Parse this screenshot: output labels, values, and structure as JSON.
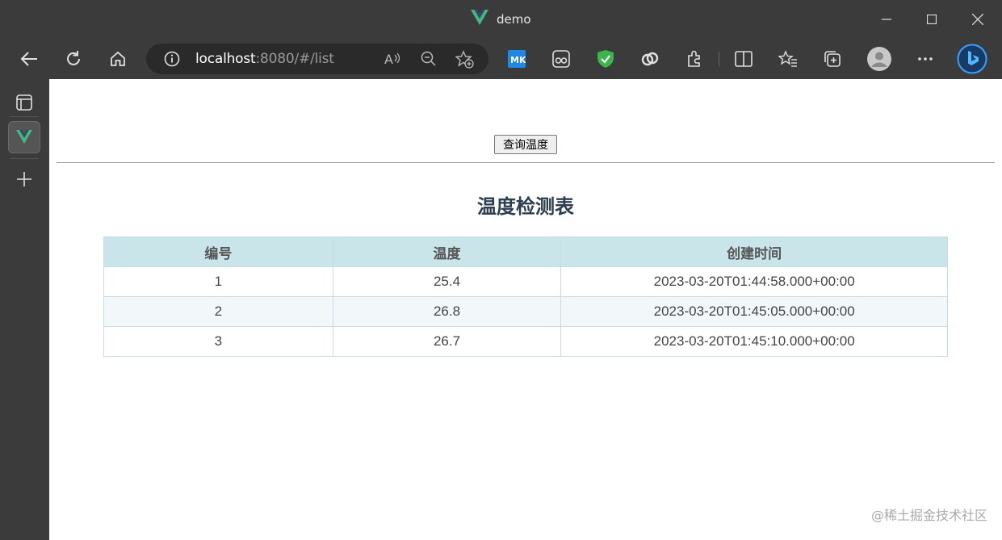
{
  "window": {
    "title": "demo"
  },
  "toolbar": {
    "url_host": "localhost",
    "url_rest": ":8080/#/list"
  },
  "page": {
    "query_button": "查询温度",
    "table_title": "温度检测表",
    "headers": [
      "编号",
      "温度",
      "创建时间"
    ],
    "rows": [
      [
        "1",
        "25.4",
        "2023-03-20T01:44:58.000+00:00"
      ],
      [
        "2",
        "26.8",
        "2023-03-20T01:45:05.000+00:00"
      ],
      [
        "3",
        "26.7",
        "2023-03-20T01:45:10.000+00:00"
      ]
    ],
    "watermark": "@稀土掘金技术社区"
  },
  "colors": {
    "chrome": "#3b3b3b",
    "vue_green": "#41b883",
    "table_header": "#c9e5ea",
    "title_text": "#2c3e50"
  }
}
